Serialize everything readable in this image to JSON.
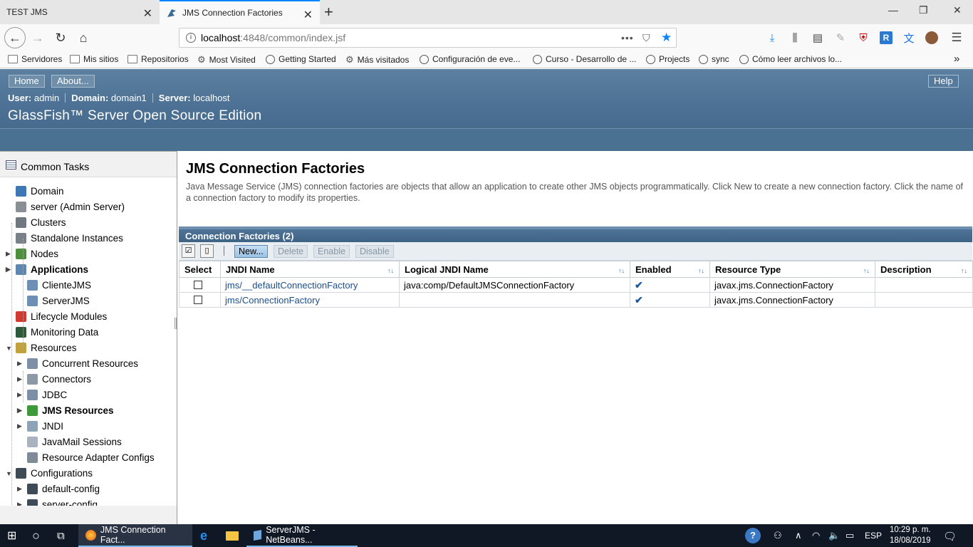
{
  "browser": {
    "tabs": [
      {
        "title": "TEST JMS",
        "active": false
      },
      {
        "title": "JMS Connection Factories",
        "active": true
      }
    ],
    "url_host": "localhost",
    "url_path": ":4848/common/index.jsf",
    "bookmarks": [
      {
        "label": "Servidores",
        "icon": "folder-icon"
      },
      {
        "label": "Mis sitios",
        "icon": "folder-icon"
      },
      {
        "label": "Repositorios",
        "icon": "folder-icon"
      },
      {
        "label": "Most Visited",
        "icon": "gear-icon"
      },
      {
        "label": "Getting Started",
        "icon": "globe-icon"
      },
      {
        "label": "Más visitados",
        "icon": "gear-icon"
      },
      {
        "label": "Configuración de eve...",
        "icon": "globe-icon"
      },
      {
        "label": "Curso - Desarrollo de ...",
        "icon": "globe-icon"
      },
      {
        "label": "Projects",
        "icon": "globe-icon"
      },
      {
        "label": "sync",
        "icon": "globe-icon"
      },
      {
        "label": "Cómo leer archivos lo...",
        "icon": "globe-icon"
      }
    ]
  },
  "header": {
    "home_label": "Home",
    "about_label": "About...",
    "help_label": "Help",
    "user_label": "User:",
    "user": "admin",
    "domain_label": "Domain:",
    "domain": "domain1",
    "server_label": "Server:",
    "server": "localhost",
    "product": "GlassFish™ Server Open Source Edition"
  },
  "tree": {
    "tab_title": "Common Tasks",
    "items": [
      {
        "label": "Domain",
        "icon": "domain-icon",
        "level": 0,
        "expander": "",
        "bold": false
      },
      {
        "label": "server (Admin Server)",
        "icon": "server-icon",
        "level": 0,
        "expander": "",
        "bold": false
      },
      {
        "label": "Clusters",
        "icon": "clusters-icon",
        "level": 0,
        "expander": "",
        "bold": false
      },
      {
        "label": "Standalone Instances",
        "icon": "instances-icon",
        "level": 0,
        "expander": "",
        "bold": false
      },
      {
        "label": "Nodes",
        "icon": "nodes-icon",
        "level": 0,
        "expander": "collapsed",
        "bold": false
      },
      {
        "label": "Applications",
        "icon": "applications-icon",
        "level": 0,
        "expander": "collapsed",
        "bold": true
      },
      {
        "label": "ClienteJMS",
        "icon": "app-icon",
        "level": 1,
        "expander": "",
        "bold": false
      },
      {
        "label": "ServerJMS",
        "icon": "app-icon",
        "level": 1,
        "expander": "",
        "bold": false
      },
      {
        "label": "Lifecycle Modules",
        "icon": "lifecycle-icon",
        "level": 0,
        "expander": "",
        "bold": false
      },
      {
        "label": "Monitoring Data",
        "icon": "monitoring-icon",
        "level": 0,
        "expander": "",
        "bold": false
      },
      {
        "label": "Resources",
        "icon": "resources-icon",
        "level": 0,
        "expander": "expanded",
        "bold": false
      },
      {
        "label": "Concurrent Resources",
        "icon": "database-icon",
        "level": 1,
        "expander": "collapsed",
        "bold": false
      },
      {
        "label": "Connectors",
        "icon": "connectors-icon",
        "level": 1,
        "expander": "collapsed",
        "bold": false
      },
      {
        "label": "JDBC",
        "icon": "database-icon",
        "level": 1,
        "expander": "collapsed",
        "bold": false
      },
      {
        "label": "JMS Resources",
        "icon": "jms-icon",
        "level": 1,
        "expander": "collapsed",
        "bold": true
      },
      {
        "label": "JNDI",
        "icon": "jndi-icon",
        "level": 1,
        "expander": "collapsed",
        "bold": false
      },
      {
        "label": "JavaMail Sessions",
        "icon": "mail-icon",
        "level": 1,
        "expander": "",
        "bold": false
      },
      {
        "label": "Resource Adapter Configs",
        "icon": "adapter-icon",
        "level": 1,
        "expander": "",
        "bold": false
      },
      {
        "label": "Configurations",
        "icon": "config-icon",
        "level": 0,
        "expander": "expanded",
        "bold": false
      },
      {
        "label": "default-config",
        "icon": "config-icon",
        "level": 1,
        "expander": "collapsed",
        "bold": false
      },
      {
        "label": "server-config",
        "icon": "config-icon",
        "level": 1,
        "expander": "collapsed",
        "bold": false
      }
    ]
  },
  "main": {
    "title": "JMS Connection Factories",
    "description": "Java Message Service (JMS) connection factories are objects that allow an application to create other JMS objects programmatically. Click New to create a new connection factory. Click the name of a connection factory to modify its properties.",
    "table_title": "Connection Factories (2)",
    "toolbar": {
      "new": "New...",
      "delete": "Delete",
      "enable": "Enable",
      "disable": "Disable"
    },
    "columns": [
      "Select",
      "JNDI Name",
      "Logical JNDI Name",
      "Enabled",
      "Resource Type",
      "Description"
    ],
    "rows": [
      {
        "jndi": "jms/__defaultConnectionFactory",
        "logical": "java:comp/DefaultJMSConnectionFactory",
        "enabled": true,
        "type": "javax.jms.ConnectionFactory",
        "description": ""
      },
      {
        "jndi": "jms/ConnectionFactory",
        "logical": "",
        "enabled": true,
        "type": "javax.jms.ConnectionFactory",
        "description": ""
      }
    ]
  },
  "taskbar": {
    "items": [
      {
        "label": "JMS Connection Fact...",
        "icon": "firefox-icon",
        "active": true
      },
      {
        "label": "",
        "icon": "edge-icon",
        "active": false
      },
      {
        "label": "",
        "icon": "file-explorer-icon",
        "active": false
      },
      {
        "label": "ServerJMS - NetBeans...",
        "icon": "netbeans-icon",
        "active": false
      }
    ],
    "lang": "ESP",
    "time": "10:29 p. m.",
    "date": "18/08/2019"
  },
  "colors": {
    "header": "#4c7194",
    "link": "#1b4f8c",
    "accent": "#0a84ff"
  }
}
